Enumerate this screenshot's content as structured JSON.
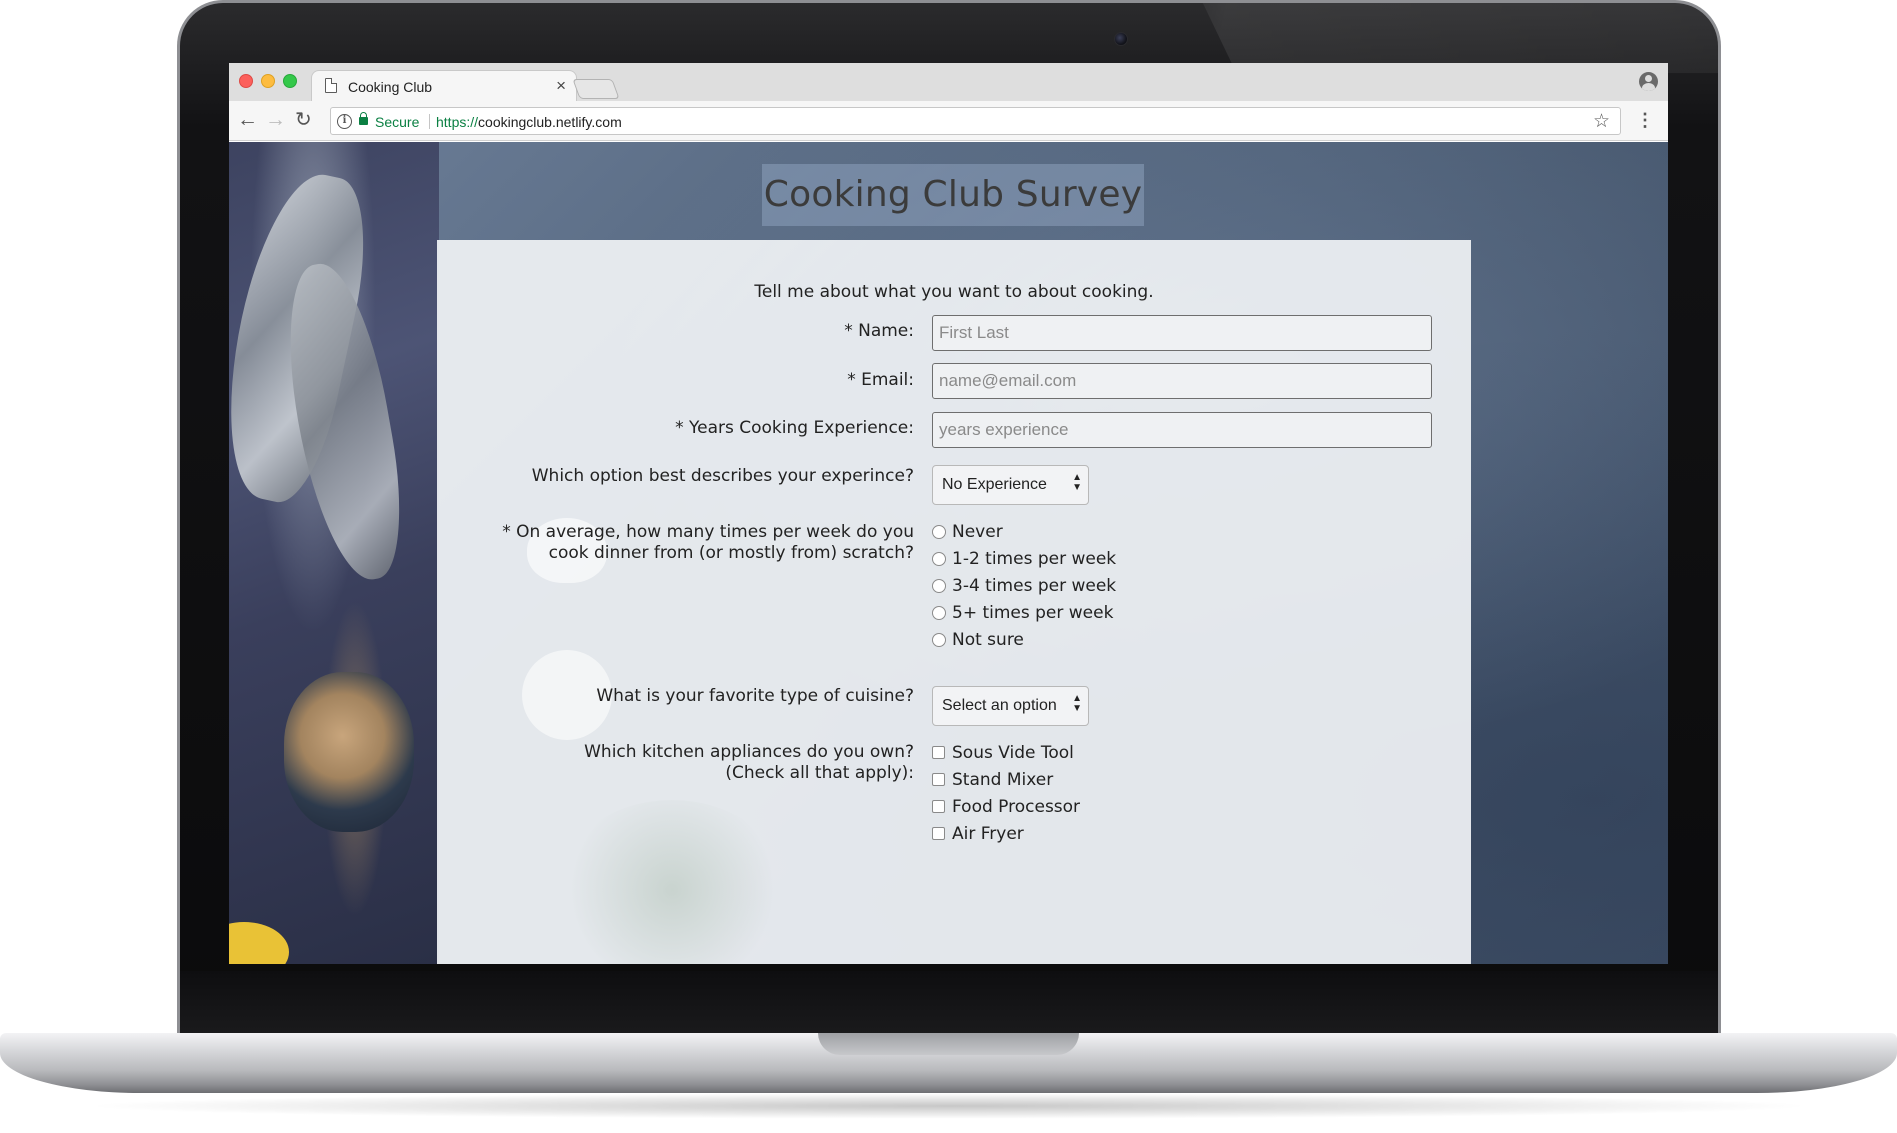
{
  "browser": {
    "tab_title": "Cooking Club",
    "tab_close": "×",
    "secure_label": "Secure",
    "url_scheme": "https://",
    "url_host": "cookingclub.netlify.com"
  },
  "page": {
    "title": "Cooking Club Survey",
    "intro": "Tell me about what you want to about cooking.",
    "name": {
      "label": "* Name:",
      "placeholder": "First Last"
    },
    "email": {
      "label": "* Email:",
      "placeholder": "name@email.com"
    },
    "years": {
      "label": "* Years Cooking Experience:",
      "placeholder": "years experience"
    },
    "experience": {
      "label": "Which option best describes your experince?",
      "selected": "No Experience"
    },
    "frequency": {
      "label_line1": "* On average, how many times per week do you",
      "label_line2": "cook dinner from (or mostly from) scratch?",
      "options": [
        "Never",
        "1-2 times per week",
        "3-4 times per week",
        "5+ times per week",
        "Not sure"
      ]
    },
    "cuisine": {
      "label": "What is your favorite type of cuisine?",
      "selected": "Select an option"
    },
    "appliances": {
      "label_line1": "Which kitchen appliances do you own?",
      "label_line2": "(Check all that apply):",
      "options": [
        "Sous Vide Tool",
        "Stand Mixer",
        "Food Processor",
        "Air Fryer"
      ]
    }
  }
}
